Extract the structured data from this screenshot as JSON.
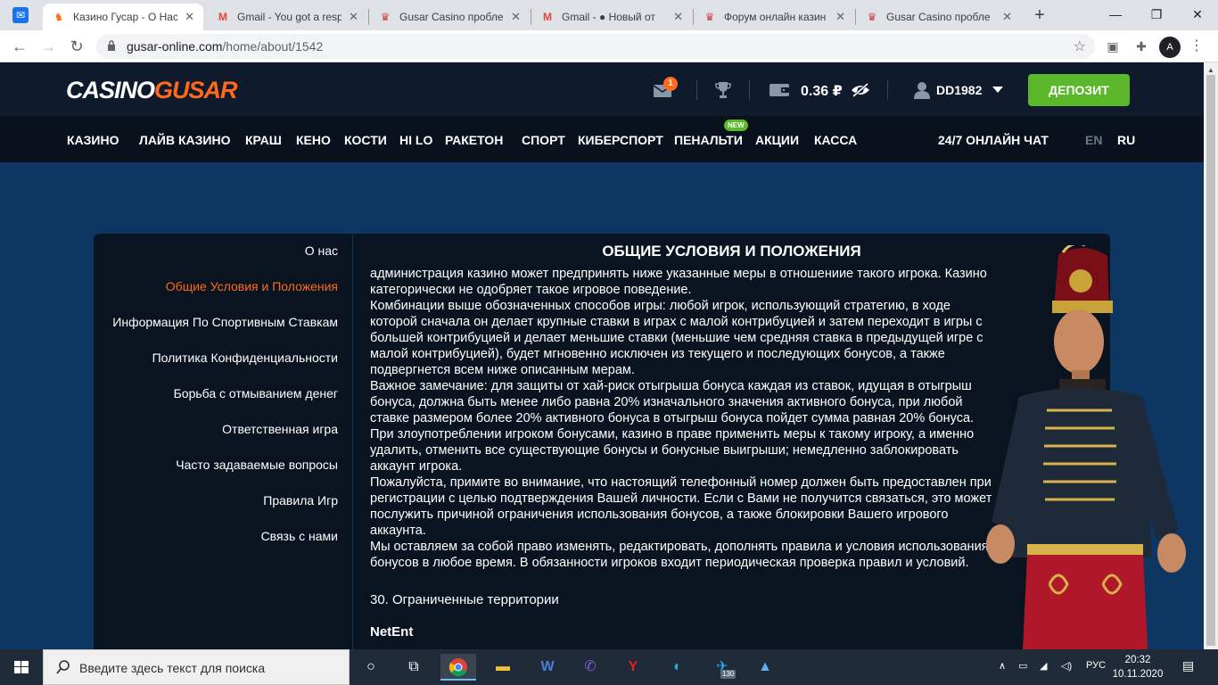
{
  "browser": {
    "tabs": [
      {
        "title": "Казино Гусар - О Нас",
        "active": true
      },
      {
        "title": "Gmail - You got a resp",
        "active": false
      },
      {
        "title": "Gusar Casino пробле",
        "active": false
      },
      {
        "title": "Gmail - ● Новый от",
        "active": false
      },
      {
        "title": "Форум онлайн казин",
        "active": false
      },
      {
        "title": "Gusar Casino пробле",
        "active": false
      }
    ],
    "url_host": "gusar-online.com",
    "url_path": "/home/about/1542",
    "profile_initial": "A"
  },
  "header": {
    "logo_part1": "CASINO",
    "logo_part2": "GUSAR",
    "mail_count": "1",
    "balance": "0.36 ₽",
    "username": "DD1982",
    "deposit_label": "ДЕПОЗИТ"
  },
  "nav": {
    "items": [
      "КАЗИНО",
      "ЛАЙВ КАЗИНО",
      "КРАШ",
      "КЕНО",
      "КОСТИ",
      "HI LO",
      "РАКЕТОН",
      "СПОРТ",
      "КИБЕРСПОРТ",
      "ПЕНАЛЬТИ",
      "АКЦИИ",
      "КАССА"
    ],
    "new_badge": "NEW",
    "chat": "24/7 ОНЛАЙН ЧАТ",
    "lang_en": "EN",
    "lang_ru": "RU"
  },
  "sidebar": {
    "items": [
      "О нас",
      "Общие Условия и Положения",
      "Информация По Спортивным Ставкам",
      "Политика Конфиденциальности",
      "Борьба с отмыванием денег",
      "Ответственная игра",
      "Часто задаваемые вопросы",
      "Правила Игр",
      "Связь с нами"
    ]
  },
  "main": {
    "title": "ОБЩИЕ УСЛОВИЯ И ПОЛОЖЕНИЯ",
    "lines": [
      "администрация казино может предпринять ниже указанные меры в отношениие такого игрока. Казино",
      "категорически не одобряет такое игровое поведение.",
      "Комбинации выше обозначенных способов игры: любой игрок, использующий стратегию, в ходе",
      "которой сначала он делает крупные ставки в играх с малой контрибуцией и затем переходит в игры с",
      "большей контрибуцией и делает меньшие ставки (меньшие чем средняя ставка в предыдущей игре с",
      "малой контрибуцией), будет мгновенно исключен из текущего и последующих бонусов, а также",
      "подвергнется всем ниже описанным мерам.",
      "Важное замечание: для защиты от хай-риск отыгрыша бонуса каждая из ставок, идущая в отыгрыш",
      "бонуса, должна быть менее либо равна 20% изначального значения активного бонуса, при любой",
      "ставке размером более 20% активного бонуса в отыгрыш бонуса пойдет сумма равная 20% бонуса.",
      "При злоупотреблении игроком бонусами, казино в праве применить меры к такому игроку, а именно",
      "удалить, отменить все существующие бонусы и бонусные выигрыши; немедленно заблокировать",
      "аккаунт игрока.",
      "Пожалуйста, примите во внимание, что настоящий телефонный номер должен быть предоставлен при",
      "регистрации с целью подтверждения Вашей личности. Если с Вами не получится связаться, это может",
      "послужить причиной ограничения использования бонусов, а также блокировки Вашего игрового",
      "аккаунта.",
      "Мы оставляем за собой право изменять, редактировать, дополнять правила и условия использования",
      "бонусов в любое время. В обязанности игроков входит периодическая проверка правил и условий."
    ],
    "section_heading": "30. Ограниченные территории",
    "section_sub": "NetEnt"
  },
  "taskbar": {
    "search_placeholder": "Введите здесь текст для поиска",
    "telegram_badge": "130",
    "lang": "РУС",
    "time": "20:32",
    "date": "10.11.2020"
  },
  "colors": {
    "accent_orange": "#ff6a1a",
    "deposit_green": "#5bb82a",
    "page_blue": "#0d3662",
    "panel_dark": "#0a1420"
  }
}
